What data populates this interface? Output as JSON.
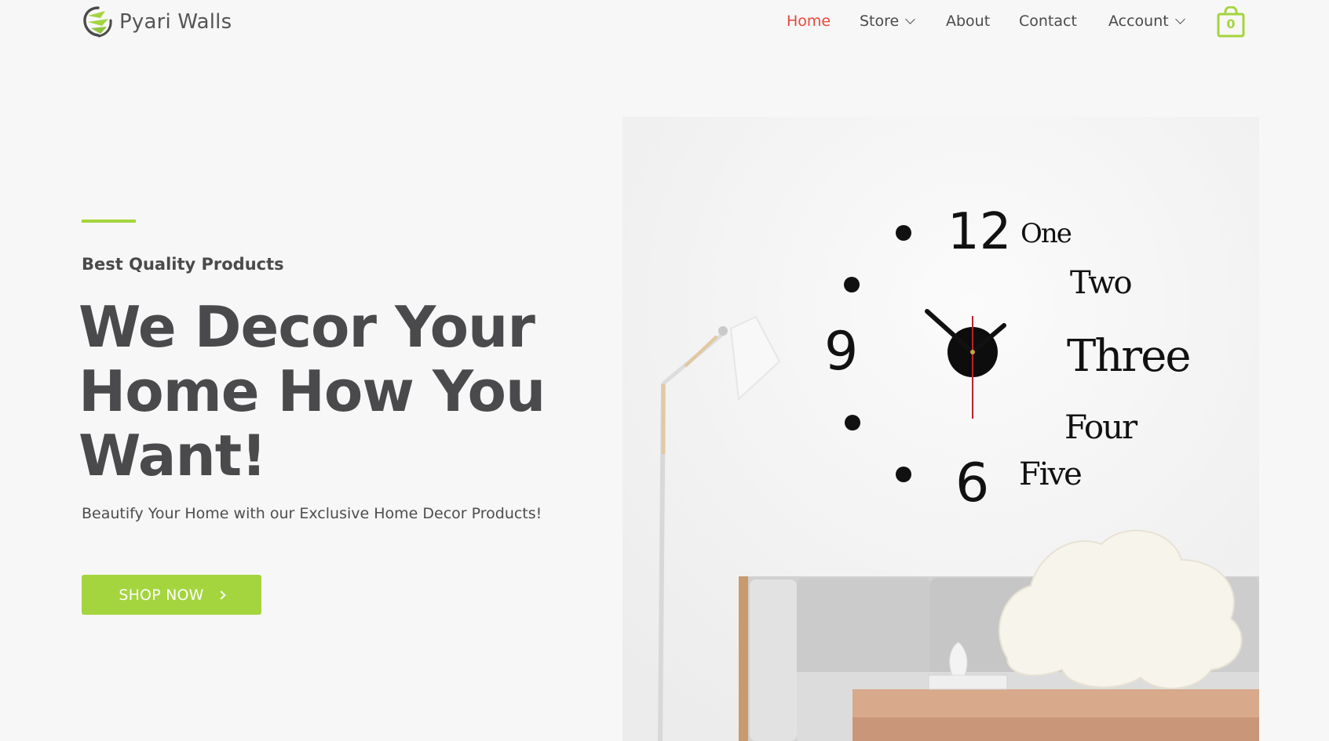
{
  "brand": {
    "name": "Pyari Walls",
    "logo_icon": "swirl-logo-icon",
    "accent": "#a4d53e"
  },
  "nav": {
    "items": [
      {
        "label": "Home",
        "active": true,
        "dropdown": false
      },
      {
        "label": "Store",
        "active": false,
        "dropdown": true
      },
      {
        "label": "About",
        "active": false,
        "dropdown": false
      },
      {
        "label": "Contact",
        "active": false,
        "dropdown": false
      },
      {
        "label": "Account",
        "active": false,
        "dropdown": true
      }
    ],
    "active_color": "#e8473b"
  },
  "cart": {
    "icon": "shopping-bag-icon",
    "count": "0"
  },
  "hero": {
    "eyebrow": "Best Quality Products",
    "headline": [
      "We Decor Your",
      "Home How You",
      "Want!"
    ],
    "subtext": "Beautify Your Home with our Exclusive Home Decor Products!",
    "cta_label": "SHOP NOW",
    "cta_icon": "chevron-right-icon"
  },
  "product_image": {
    "clock_numbers": [
      "12",
      "9",
      "6"
    ],
    "clock_words": [
      "One",
      "Two",
      "Three",
      "Four",
      "Five"
    ]
  }
}
